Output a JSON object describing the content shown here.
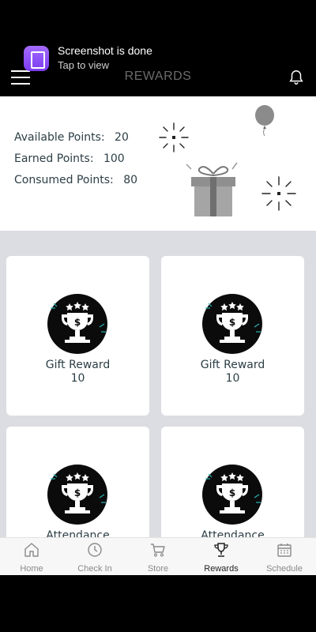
{
  "header": {
    "title": "REWARDS"
  },
  "toast": {
    "title": "Screenshot is done",
    "subtitle": "Tap to view"
  },
  "points": {
    "available_label": "Available Points:",
    "available_value": "20",
    "earned_label": "Earned Points:",
    "earned_value": "100",
    "consumed_label": "Consumed Points:",
    "consumed_value": "80"
  },
  "rewards": [
    {
      "name": "Gift Reward",
      "points": "10"
    },
    {
      "name": "Gift Reward",
      "points": "10"
    },
    {
      "name": "Attendance",
      "points": ""
    },
    {
      "name": "Attendance",
      "points": ""
    }
  ],
  "nav": [
    {
      "label": "Home",
      "icon": "home-icon",
      "active": false
    },
    {
      "label": "Check In",
      "icon": "clock-icon",
      "active": false
    },
    {
      "label": "Store",
      "icon": "cart-icon",
      "active": false
    },
    {
      "label": "Rewards",
      "icon": "trophy-icon",
      "active": true
    },
    {
      "label": "Schedule",
      "icon": "calendar-icon",
      "active": false
    }
  ],
  "colors": {
    "accent_text": "#2c3e45",
    "nav_active": "#1f1f1f",
    "nav_inactive": "#8a8a8a",
    "grid_bg": "#dcdde2"
  }
}
